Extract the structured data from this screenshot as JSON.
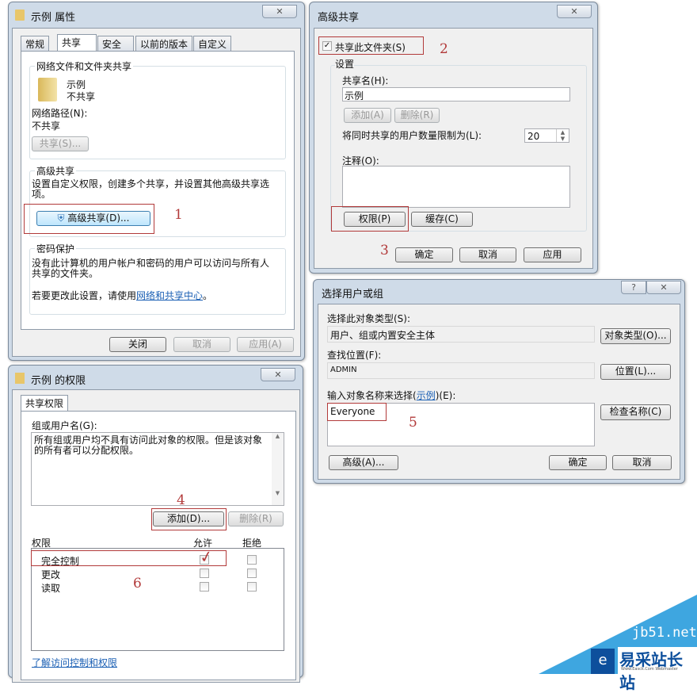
{
  "props": {
    "title": "示例 属性",
    "close": "✕",
    "tabs": [
      "常规",
      "共享",
      "安全",
      "以前的版本",
      "自定义"
    ],
    "net_group": "网络文件和文件夹共享",
    "folder_name": "示例",
    "folder_status": "不共享",
    "net_path_label": "网络路径(N):",
    "net_path": "不共享",
    "share_btn": "共享(S)...",
    "adv_group": "高级共享",
    "adv_desc": "设置自定义权限，创建多个共享，并设置其他高级共享选项。",
    "adv_btn": "高级共享(D)...",
    "pwd_group": "密码保护",
    "pwd_desc": "没有此计算机的用户帐户和密码的用户可以访问与所有人共享的文件夹。",
    "pwd_change": "若要更改此设置，请使用",
    "pwd_link": "网络和共享中心",
    "pwd_end": "。",
    "ok": "关闭",
    "cancel": "取消",
    "apply": "应用(A)"
  },
  "adv": {
    "title": "高级共享",
    "close": "✕",
    "share_check": "共享此文件夹(S)",
    "settings": "设置",
    "share_name_label": "共享名(H):",
    "share_name": "示例",
    "add": "添加(A)",
    "remove": "删除(R)",
    "limit_label": "将同时共享的用户数量限制为(L):",
    "limit": "20",
    "comment_label": "注释(O):",
    "comment": "",
    "perm_btn": "权限(P)",
    "cache_btn": "缓存(C)",
    "ok": "确定",
    "cancel": "取消",
    "apply": "应用"
  },
  "sel": {
    "title": "选择用户或组",
    "help": "?",
    "close": "✕",
    "type_label": "选择此对象类型(S):",
    "type_value": "用户、组或内置安全主体",
    "type_btn": "对象类型(O)...",
    "loc_label": "查找位置(F):",
    "loc_value": "ADMIN",
    "loc_btn": "位置(L)...",
    "name_label": "输入对象名称来选择(",
    "name_link": "示例",
    "name_label_end": ")(E):",
    "name_value": "Everyone",
    "check_btn": "检查名称(C)",
    "advanced": "高级(A)...",
    "ok": "确定",
    "cancel": "取消"
  },
  "perm": {
    "title": "示例 的权限",
    "close": "✕",
    "tab": "共享权限",
    "group_label": "组或用户名(G):",
    "list_msg": "所有组或用户均不具有访问此对象的权限。但是该对象的所有者可以分配权限。",
    "add": "添加(D)...",
    "remove": "删除(R)",
    "col_perm": "权限",
    "col_allow": "允许",
    "col_deny": "拒绝",
    "rows": [
      {
        "name": "完全控制",
        "allow": true,
        "deny": false
      },
      {
        "name": "更改",
        "allow": false,
        "deny": false
      },
      {
        "name": "读取",
        "allow": false,
        "deny": false
      }
    ],
    "help_link": "了解访问控制和权限"
  },
  "steps": [
    "1",
    "2",
    "3",
    "4",
    "5",
    "6"
  ],
  "watermark": {
    "site": "jb51.net",
    "brand": "易采站长站",
    "sub": "Www.Easck.Com Webmaster"
  },
  "colors": {
    "annotation": "#b23a3a",
    "link": "#1a5fb4",
    "watermark": "#3ea6e0"
  }
}
